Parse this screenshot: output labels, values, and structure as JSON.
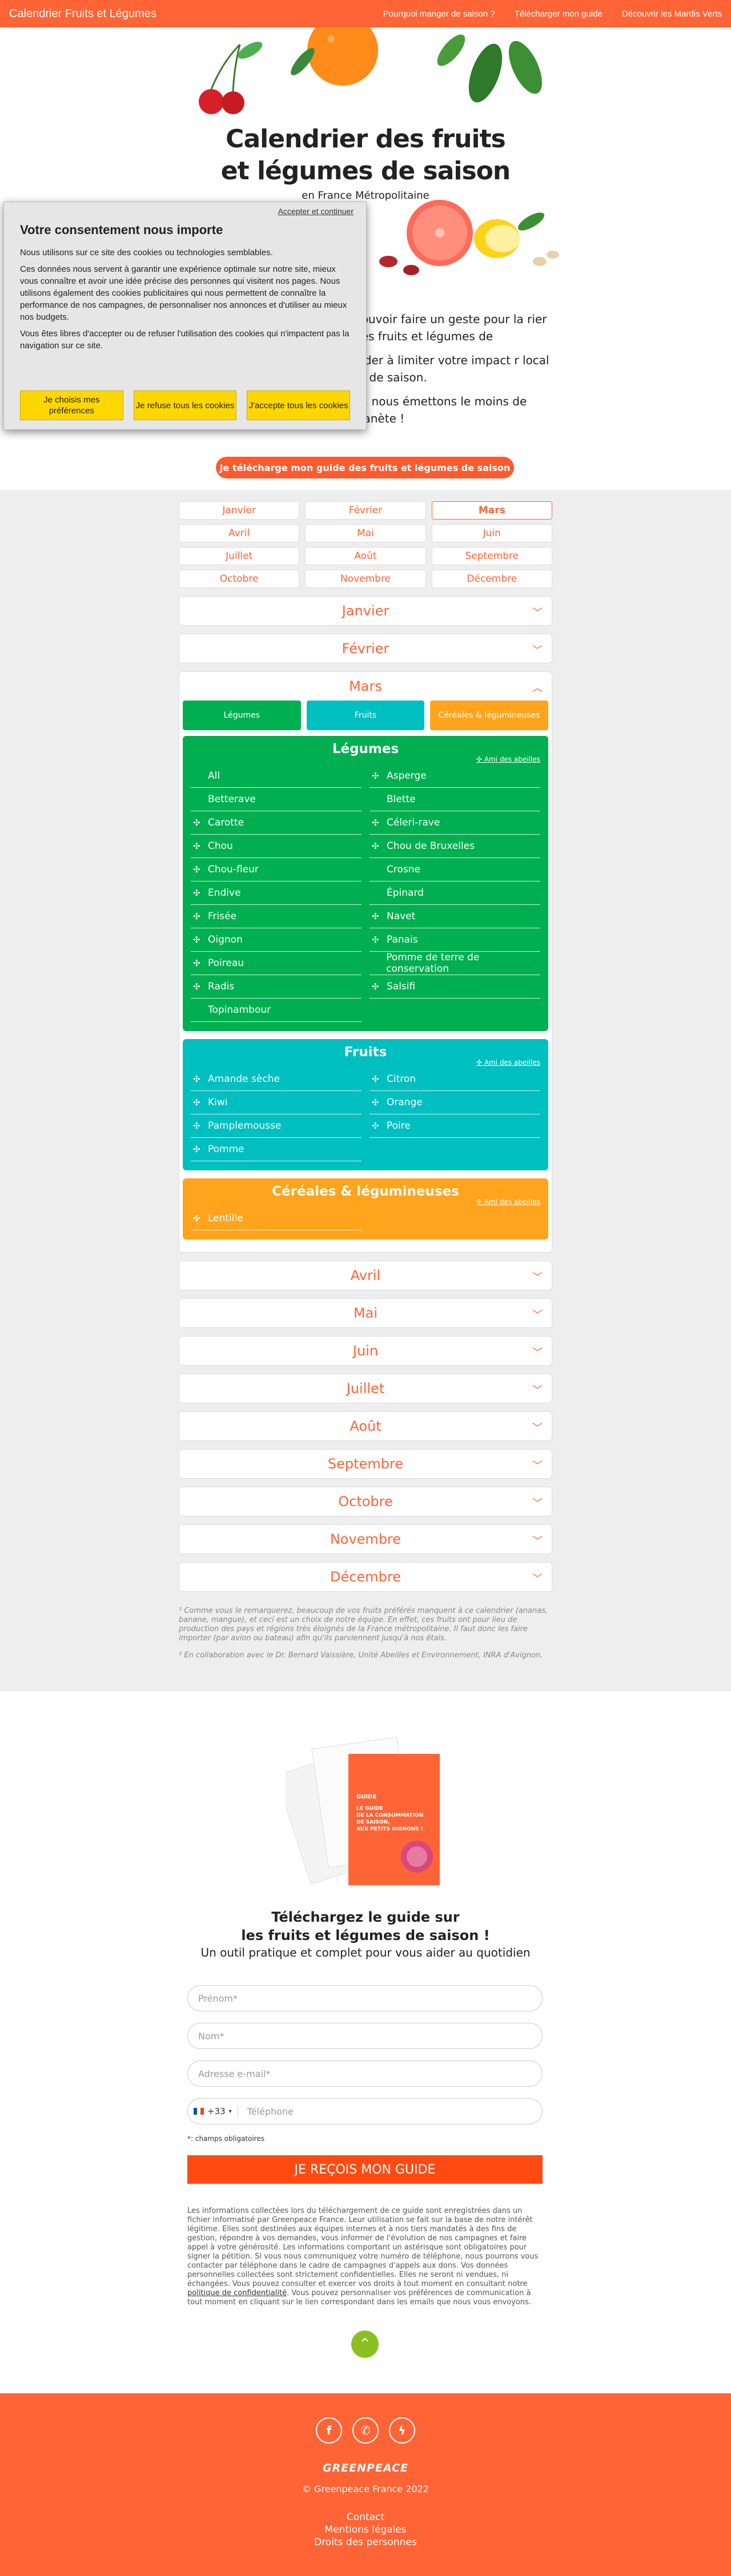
{
  "header": {
    "brand": "Calendrier Fruits et Légumes",
    "nav": [
      "Pourquoi manger de saison ?",
      "Télécharger mon guide",
      "Découvrir les Mardis Verts"
    ]
  },
  "hero": {
    "title_line1": "Calendrier des fruits",
    "title_line2": "et légumes de saison",
    "subtitle": "en France Métropolitaine",
    "para1": "pouvoir faire un geste pour la rier des fruits et légumes de",
    "para2": "aider à limiter votre impact r local et de saison.",
    "para3": "al, nous émettons le moins de serre et ça, c'est bon pour la planète !",
    "cta": "Je télécharge mon guide des fruits et légumes de saison"
  },
  "consent": {
    "accept_link": "Accepter et continuer",
    "title": "Votre consentement nous importe",
    "p1": "Nous utilisons sur ce site des cookies ou technologies semblables.",
    "p2": "Ces données nous servent à garantir une expérience optimale sur notre site, mieux vous connaître et avoir une idée précise des personnes qui visitent nos pages. Nous utilisons également des cookies publicitaires qui nous permettent de connaître la performance de nos campagnes, de personnaliser nos annonces et d'utiliser au mieux nos budgets.",
    "p3": "Vous êtes libres d'accepter ou de refuser l'utilisation des cookies qui n'impactent pas la navigation sur ce site.",
    "btn_prefs": "Je choisis mes préférences",
    "btn_refuse": "Je refuse tous les cookies",
    "btn_accept": "J'accepte tous les cookies"
  },
  "months": [
    "Janvier",
    "Février",
    "Mars",
    "Avril",
    "Mai",
    "Juin",
    "Juillet",
    "Août",
    "Septembre",
    "Octobre",
    "Novembre",
    "Décembre"
  ],
  "active_month": "Mars",
  "march": {
    "tabs": [
      "Légumes",
      "Fruits",
      "Céréales & légumineuses"
    ],
    "bee_label": "Ami des abeilles",
    "legumes": {
      "title": "Légumes",
      "items": [
        {
          "label": "All",
          "bee": false
        },
        {
          "label": "Asperge",
          "bee": true
        },
        {
          "label": "Betterave",
          "bee": false
        },
        {
          "label": "Blette",
          "bee": false
        },
        {
          "label": "Carotte",
          "bee": true
        },
        {
          "label": "Céleri-rave",
          "bee": true
        },
        {
          "label": "Chou",
          "bee": true
        },
        {
          "label": "Chou de Bruxelles",
          "bee": true
        },
        {
          "label": "Chou-fleur",
          "bee": true
        },
        {
          "label": "Crosne",
          "bee": false
        },
        {
          "label": "Endive",
          "bee": true
        },
        {
          "label": "Épinard",
          "bee": false
        },
        {
          "label": "Frisée",
          "bee": true
        },
        {
          "label": "Navet",
          "bee": true
        },
        {
          "label": "Oignon",
          "bee": true
        },
        {
          "label": "Panais",
          "bee": true
        },
        {
          "label": "Poireau",
          "bee": true
        },
        {
          "label": "Pomme de terre de conservation",
          "bee": false
        },
        {
          "label": "Radis",
          "bee": true
        },
        {
          "label": "Salsifi",
          "bee": true
        },
        {
          "label": "Topinambour",
          "bee": false
        }
      ]
    },
    "fruits": {
      "title": "Fruits",
      "items": [
        {
          "label": "Amande sèche",
          "bee": true
        },
        {
          "label": "Citron",
          "bee": true
        },
        {
          "label": "Kiwi",
          "bee": true
        },
        {
          "label": "Orange",
          "bee": true
        },
        {
          "label": "Pamplemousse",
          "bee": true
        },
        {
          "label": "Poire",
          "bee": true
        },
        {
          "label": "Pomme",
          "bee": true
        }
      ]
    },
    "cereales": {
      "title": "Céréales & légumineuses",
      "items": [
        {
          "label": "Lentille",
          "bee": true
        }
      ]
    }
  },
  "notes": {
    "n1": "¹ Comme vous le remarquerez, beaucoup de vos fruits préférés manquent à ce calendrier (ananas, banane, mangue), et ceci est un choix de notre équipe. En effet, ces fruits ont pour lieu de production des pays et régions très éloignés de la France métropolitaine. Il faut donc les faire importer (par avion ou bateau) afin qu'ils parviennent jusqu'à nos étals.",
    "n2": "² En collaboration avec le Dr. Bernard Vaissière, Unité Abeilles et Environnement, INRA d'Avignon."
  },
  "guide": {
    "book_line1": "GUIDE",
    "book_line2": "LE GUIDE DE LA CONSOMMATION DE SAISON, AUX PETITS OIGNONS !",
    "title_line1": "Téléchargez le guide sur",
    "title_line2": "les fruits et légumes de saison !",
    "subtitle": "Un outil pratique et complet pour vous aider au quotidien",
    "firstname_ph": "Prénom*",
    "lastname_ph": "Nom*",
    "email_ph": "Adresse e-mail*",
    "country_code": "+33",
    "phone_ph": "Téléphone",
    "required_note": "*: champs obligatoires",
    "submit": "JE REÇOIS MON GUIDE",
    "legal": "Les informations collectées lors du téléchargement de ce guide sont enregistrées dans un fichier informatisé par Greenpeace France. Leur utilisation se fait sur la base de notre intérêt légitime. Elles sont destinées aux équipes internes et à nos tiers mandatés à des fins de gestion, répondre à vos demandes, vous informer de l'évolution de nos campagnes et faire appel à votre générosité. Les informations comportant un astérisque sont obligatoires pour signer la pétition. Si vous nous communiquez votre numéro de téléphone, nous pourrons vous contacter par téléphone dans le cadre de campagnes d'appels aux dons. Vos données personnelles collectées sont strictement confidentielles. Elles ne seront ni vendues, ni échangées. Vous pouvez consulter et exercer vos droits à tout moment en consultant notre",
    "legal_link": "politique de confidentialité",
    "legal_end": ". Vous pouvez personnaliser vos préférences de communication à tout moment en cliquant sur le lien correspondant dans les emails que nous vous envoyons."
  },
  "footer": {
    "logo": "GREENPEACE",
    "copyright": "© Greenpeace France 2022",
    "links": [
      "Contact",
      "Mentions légales",
      "Droits des personnes"
    ]
  },
  "colors": {
    "brand": "#ff6436",
    "legumes": "#00b050",
    "fruits": "#00bfc0",
    "cereales": "#ffa41c",
    "consent_button": "#ffd700"
  },
  "icons": {
    "bee": "bee-icon",
    "chevron": "chevron-down-icon",
    "social": [
      "facebook-icon",
      "whatsapp-icon",
      "messenger-icon"
    ],
    "back_to_top": "chevron-up-icon"
  }
}
